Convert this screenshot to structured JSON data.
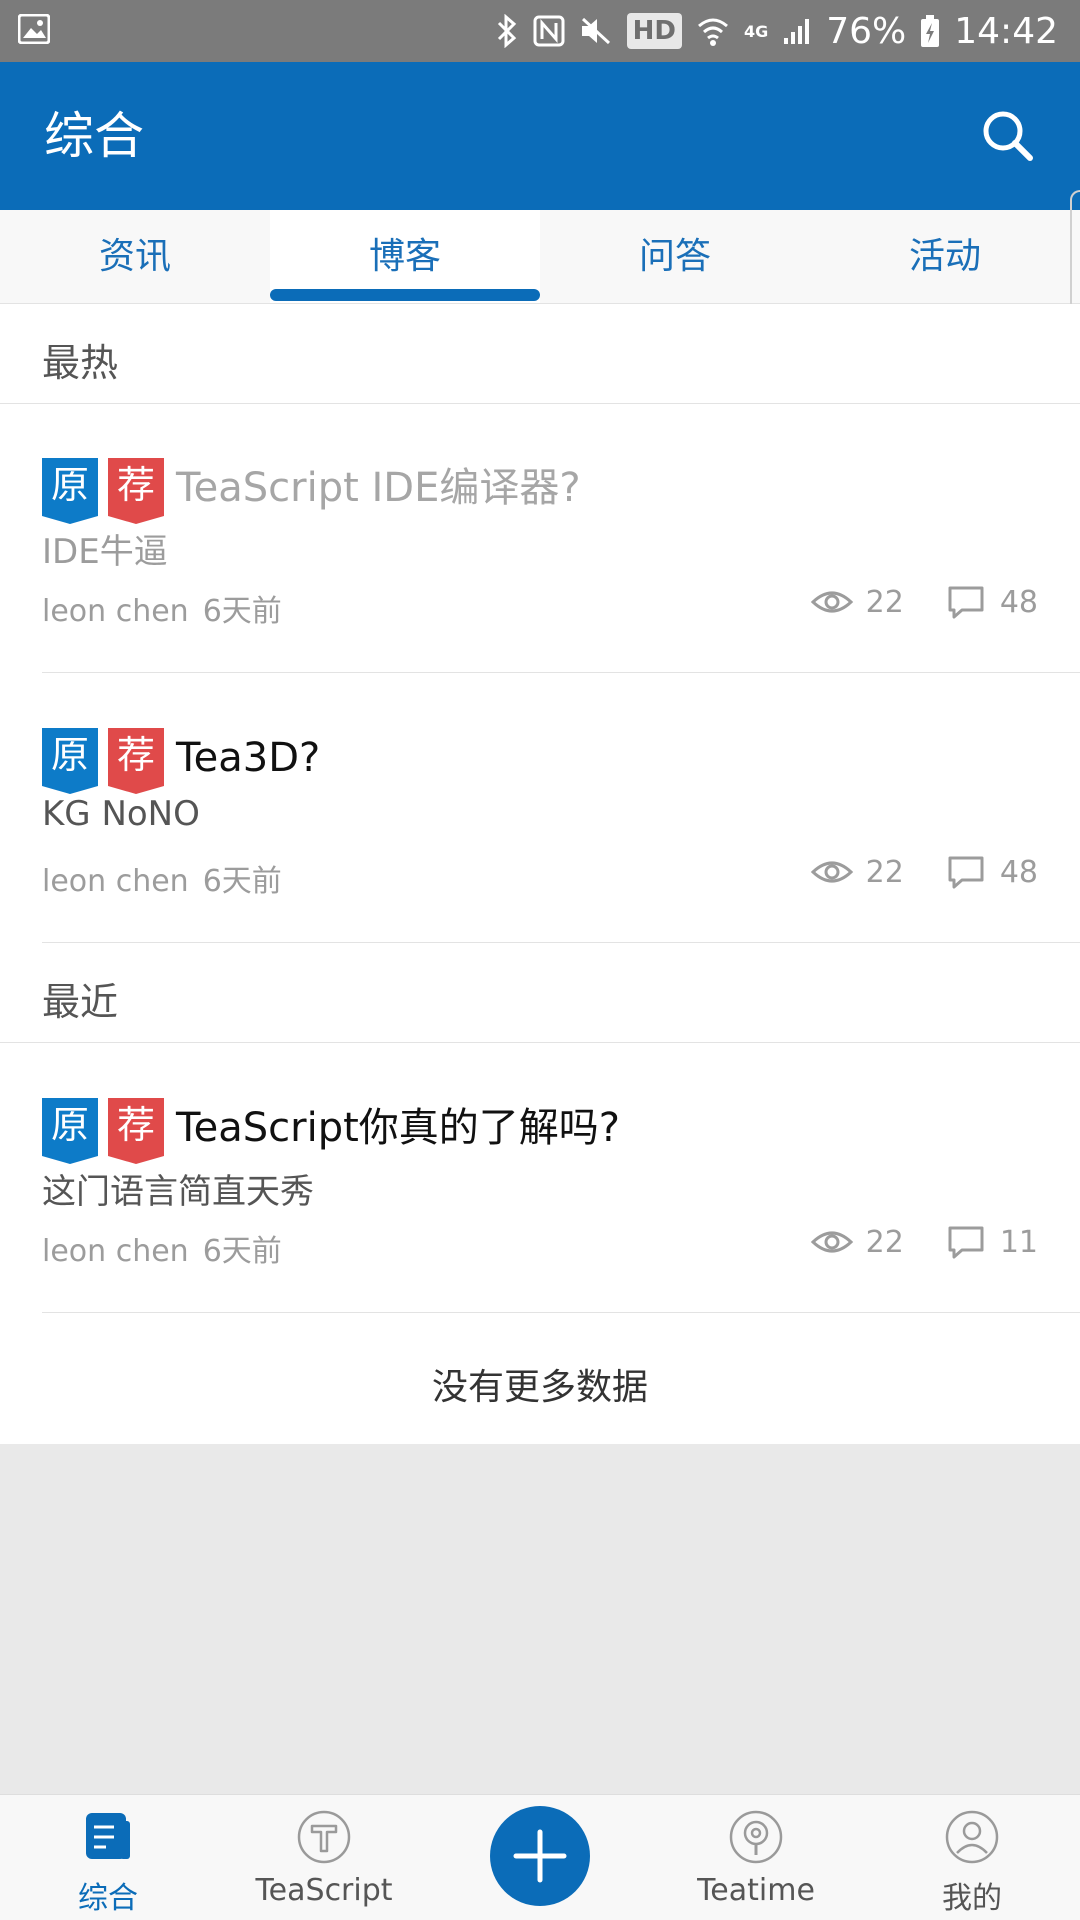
{
  "status_bar": {
    "battery": "76%",
    "time": "14:42",
    "hd_label": "HD",
    "network_label": "4G",
    "icons": [
      "gallery-icon",
      "bluetooth-icon",
      "nfc-icon",
      "mute-icon",
      "wifi-icon",
      "signal-icon",
      "battery-icon"
    ]
  },
  "app_bar": {
    "title": "综合",
    "search_icon": "search-icon"
  },
  "tabs": [
    {
      "label": "资讯",
      "active": false
    },
    {
      "label": "博客",
      "active": true
    },
    {
      "label": "问答",
      "active": false
    },
    {
      "label": "活动",
      "active": false
    }
  ],
  "sections": {
    "hot": "最热",
    "recent": "最近"
  },
  "badges": {
    "original": "原",
    "recommended": "荐"
  },
  "posts": [
    {
      "title": "TeaScript IDE编译器?",
      "summary": "IDE牛逼",
      "author": "leon chen",
      "time": "6天前",
      "views": "22",
      "comments": "48",
      "faded": true
    },
    {
      "title": "Tea3D?",
      "summary": "KG NoNO",
      "author": "leon chen",
      "time": "6天前",
      "views": "22",
      "comments": "48",
      "faded": false
    },
    {
      "title": "TeaScript你真的了解吗?",
      "summary": "这门语言简直天秀",
      "author": "leon chen",
      "time": "6天前",
      "views": "22",
      "comments": "11",
      "faded": false
    }
  ],
  "footer_note": "没有更多数据",
  "bottom_nav": [
    {
      "label": "综合",
      "icon": "news-icon",
      "active": true
    },
    {
      "label": "TeaScript",
      "icon": "teascript-icon",
      "active": false
    },
    {
      "label": "",
      "icon": "add-icon",
      "active": false
    },
    {
      "label": "Teatime",
      "icon": "teatime-icon",
      "active": false
    },
    {
      "label": "我的",
      "icon": "profile-icon",
      "active": false
    }
  ],
  "colors": {
    "primary": "#0b6cb8",
    "badge_blue": "#0d7bc8",
    "badge_red": "#e04a4a",
    "status_bar": "#7b7b7b"
  }
}
